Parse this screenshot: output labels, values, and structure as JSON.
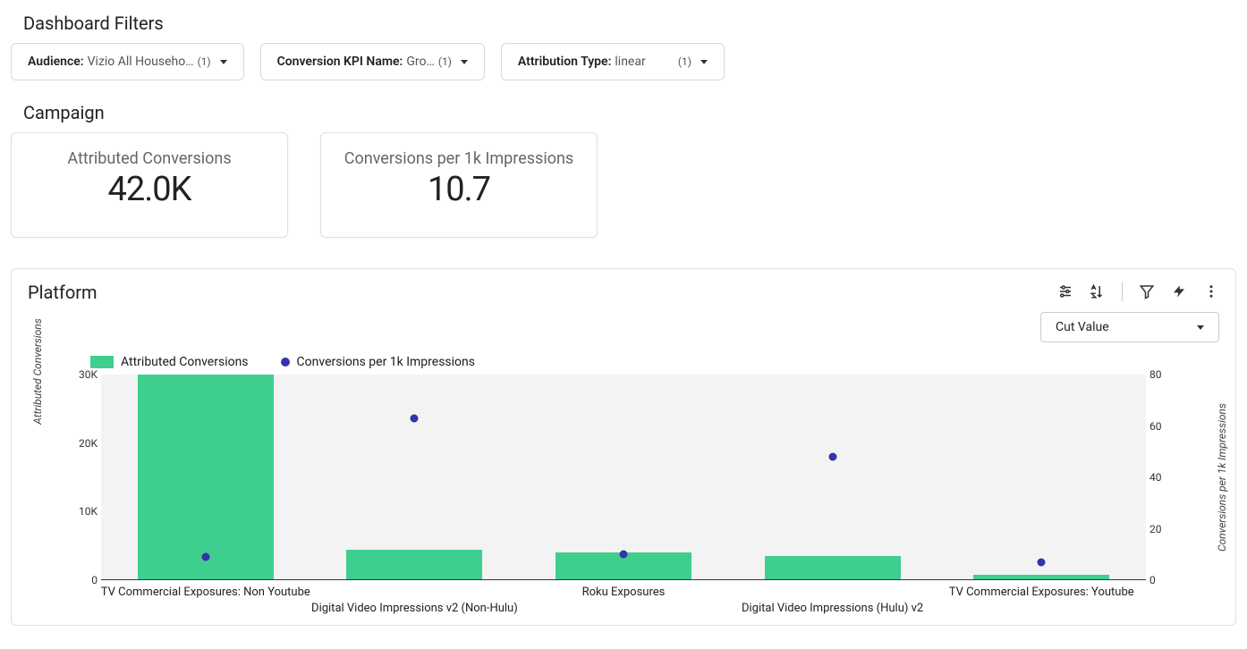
{
  "filters_heading": "Dashboard Filters",
  "filters": [
    {
      "name": "Audience",
      "value": "Vizio All Househo…",
      "count": "(1)"
    },
    {
      "name": "Conversion KPI Name",
      "value": "Gro…",
      "count": "(1)"
    },
    {
      "name": "Attribution Type",
      "value": "linear",
      "count": "(1)"
    }
  ],
  "campaign_heading": "Campaign",
  "kpis": [
    {
      "label": "Attributed Conversions",
      "value": "42.0K"
    },
    {
      "label": "Conversions per 1k Impressions",
      "value": "10.7"
    }
  ],
  "platform": {
    "title": "Platform",
    "cut_value_label": "Cut Value",
    "legend": {
      "bar": "Attributed Conversions",
      "dot": "Conversions per 1k Impressions"
    },
    "y_left_label": "Attributed Conversions",
    "y_right_label": "Conversions per 1k Impressions",
    "y_left_ticks": [
      "0",
      "10K",
      "20K",
      "30K"
    ],
    "y_right_ticks": [
      "0",
      "20",
      "40",
      "60",
      "80"
    ]
  },
  "chart_data": {
    "type": "bar",
    "categories": [
      "TV Commercial Exposures: Non Youtube",
      "Digital Video Impressions v2 (Non-Hulu)",
      "Roku Exposures",
      "Digital Video Impressions (Hulu) v2",
      "TV Commercial Exposures: Youtube"
    ],
    "series": [
      {
        "name": "Attributed Conversions",
        "type": "bar",
        "values": [
          30000,
          4500,
          4000,
          3500,
          800
        ]
      },
      {
        "name": "Conversions per 1k Impressions",
        "type": "scatter",
        "values": [
          9,
          63,
          10,
          48,
          7
        ]
      }
    ],
    "y_left_lim": [
      0,
      30000
    ],
    "y_right_lim": [
      0,
      80
    ],
    "colors": {
      "bar": "#3ecf8e",
      "dot": "#3333aa"
    }
  }
}
